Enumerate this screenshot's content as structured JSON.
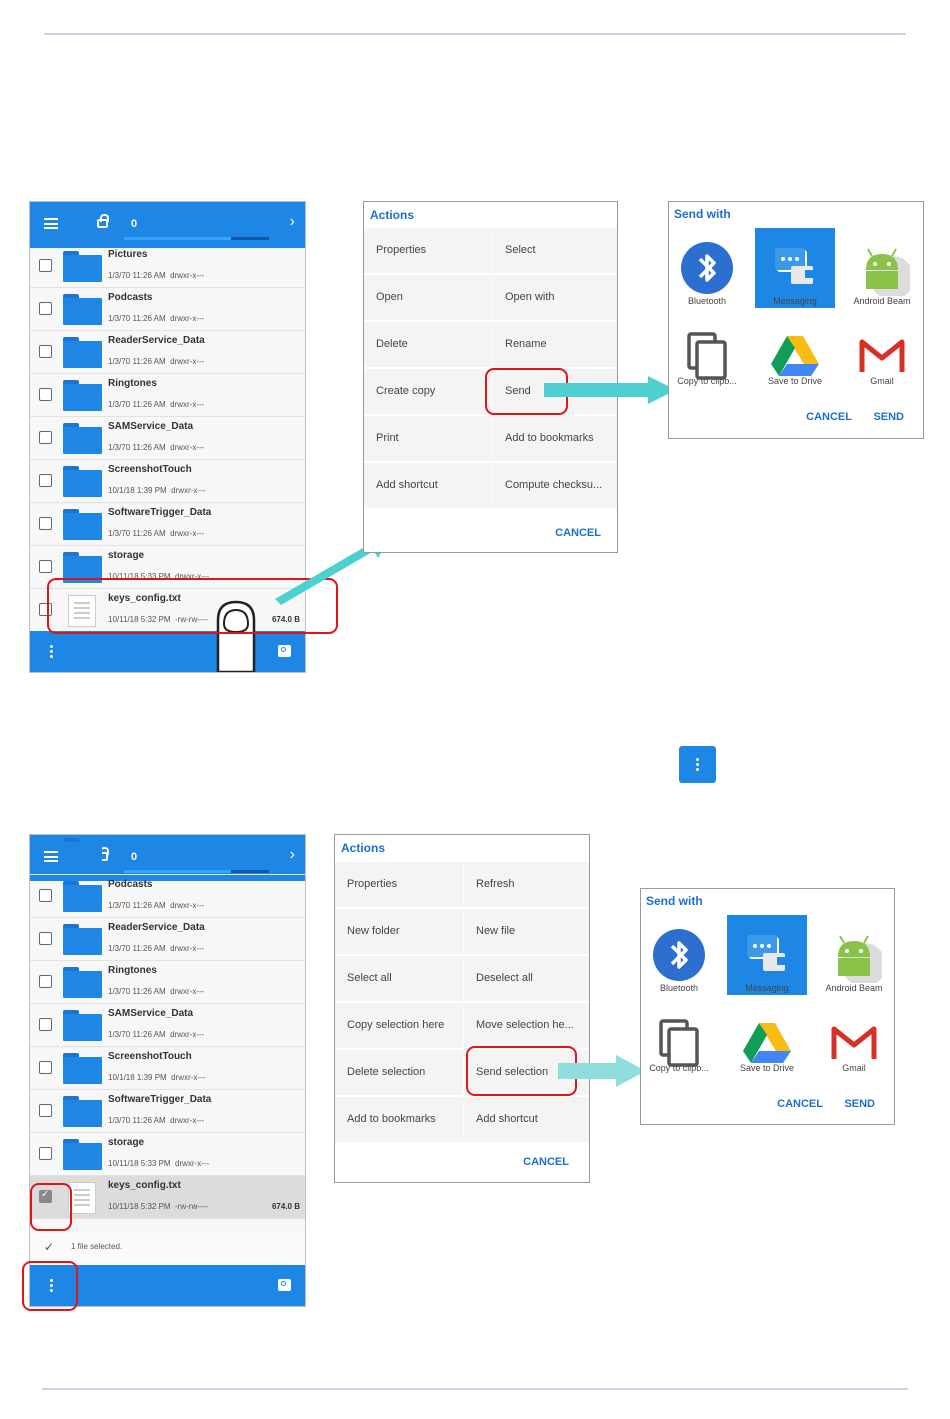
{
  "phone1": {
    "selected_count": "0",
    "files": [
      {
        "name": "Pictures",
        "date": "1/3/70 11:26 AM",
        "perm": "drwxr-x---",
        "size": "",
        "type": "folder"
      },
      {
        "name": "Podcasts",
        "date": "1/3/70 11:26 AM",
        "perm": "drwxr-x---",
        "size": "",
        "type": "folder"
      },
      {
        "name": "ReaderService_Data",
        "date": "1/3/70 11:26 AM",
        "perm": "drwxr-x---",
        "size": "",
        "type": "folder"
      },
      {
        "name": "Ringtones",
        "date": "1/3/70 11:26 AM",
        "perm": "drwxr-x---",
        "size": "",
        "type": "folder"
      },
      {
        "name": "SAMService_Data",
        "date": "1/3/70 11:26 AM",
        "perm": "drwxr-x---",
        "size": "",
        "type": "folder"
      },
      {
        "name": "ScreenshotTouch",
        "date": "10/1/18 1:39 PM",
        "perm": "drwxr-x---",
        "size": "",
        "type": "folder"
      },
      {
        "name": "SoftwareTrigger_Data",
        "date": "1/3/70 11:26 AM",
        "perm": "drwxr-x---",
        "size": "",
        "type": "folder"
      },
      {
        "name": "storage",
        "date": "10/11/18 5:33 PM",
        "perm": "drwxr-x---",
        "size": "",
        "type": "folder"
      },
      {
        "name": "keys_config.txt",
        "date": "10/11/18 5:32 PM",
        "perm": "-rw-rw----",
        "size": "674.0 B",
        "type": "file"
      }
    ]
  },
  "actions1": {
    "title": "Actions",
    "items": [
      [
        "Properties",
        "Select"
      ],
      [
        "Open",
        "Open with"
      ],
      [
        "Delete",
        "Rename"
      ],
      [
        "Create copy",
        "Send"
      ],
      [
        "Print",
        "Add to bookmarks"
      ],
      [
        "Add shortcut",
        "Compute checksu..."
      ]
    ],
    "cancel": "CANCEL"
  },
  "share": {
    "title": "Send with",
    "apps": [
      "Bluetooth",
      "Messaging",
      "Android Beam",
      "Copy to clipb...",
      "Save to Drive",
      "Gmail"
    ],
    "cancel": "CANCEL",
    "send": "SEND"
  },
  "phone2": {
    "selected_count": "0",
    "files": [
      {
        "name": "Podcasts",
        "date": "1/3/70 11:26 AM",
        "perm": "drwxr-x---",
        "size": "",
        "type": "folder"
      },
      {
        "name": "ReaderService_Data",
        "date": "1/3/70 11:26 AM",
        "perm": "drwxr-x---",
        "size": "",
        "type": "folder"
      },
      {
        "name": "Ringtones",
        "date": "1/3/70 11:26 AM",
        "perm": "drwxr-x---",
        "size": "",
        "type": "folder"
      },
      {
        "name": "SAMService_Data",
        "date": "1/3/70 11:26 AM",
        "perm": "drwxr-x---",
        "size": "",
        "type": "folder"
      },
      {
        "name": "ScreenshotTouch",
        "date": "10/1/18 1:39 PM",
        "perm": "drwxr-x---",
        "size": "",
        "type": "folder"
      },
      {
        "name": "SoftwareTrigger_Data",
        "date": "1/3/70 11:26 AM",
        "perm": "drwxr-x---",
        "size": "",
        "type": "folder"
      },
      {
        "name": "storage",
        "date": "10/11/18 5:33 PM",
        "perm": "drwxr-x---",
        "size": "",
        "type": "folder"
      },
      {
        "name": "keys_config.txt",
        "date": "10/11/18 5:32 PM",
        "perm": "-rw-rw----",
        "size": "674.0 B",
        "type": "file"
      }
    ],
    "selection_status": "1 file selected."
  },
  "actions2": {
    "title": "Actions",
    "items": [
      [
        "Properties",
        "Refresh"
      ],
      [
        "New folder",
        "New file"
      ],
      [
        "Select all",
        "Deselect all"
      ],
      [
        "Copy selection here",
        "Move selection he..."
      ],
      [
        "Delete selection",
        "Send selection"
      ],
      [
        "Add to bookmarks",
        "Add shortcut"
      ]
    ],
    "cancel": "CANCEL"
  },
  "colors": {
    "accent": "#1e87e6",
    "highlight": "#e0141b",
    "arrow": "#4fd0d0"
  }
}
